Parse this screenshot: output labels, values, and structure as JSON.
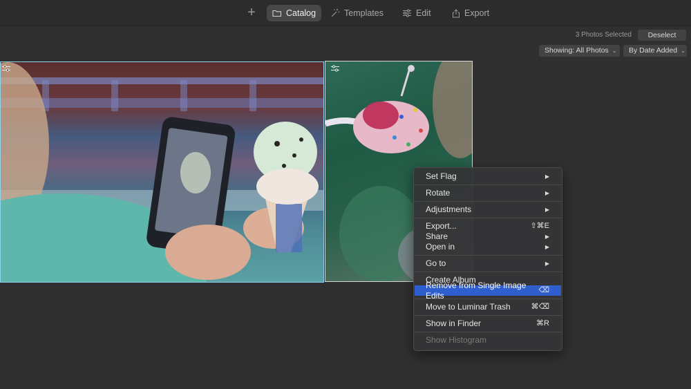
{
  "toolbar": {
    "add_label": "+",
    "tabs": [
      {
        "label": "Catalog",
        "icon": "folder-icon",
        "active": true
      },
      {
        "label": "Templates",
        "icon": "magic-wand-icon",
        "active": false
      },
      {
        "label": "Edit",
        "icon": "sliders-icon",
        "active": false
      },
      {
        "label": "Export",
        "icon": "export-icon",
        "active": false
      }
    ]
  },
  "header": {
    "selection_count": "3 Photos Selected",
    "deselect_label": "Deselect",
    "showing_label": "Showing: All Photos",
    "sort_label": "By Date Added"
  },
  "photos": [
    {
      "description_icon": "adjustments-icon",
      "selected": true
    },
    {
      "description_icon": "adjustments-icon",
      "selected": true
    }
  ],
  "context_menu": {
    "items": [
      {
        "label": "Set Flag",
        "shortcut": "",
        "submenu": true
      },
      {
        "label": "Rotate",
        "shortcut": "",
        "submenu": true
      },
      {
        "label": "Adjustments",
        "shortcut": "",
        "submenu": true
      },
      {
        "label": "Export...",
        "shortcut": "⇧⌘E",
        "submenu": false
      },
      {
        "label": "Share",
        "shortcut": "",
        "submenu": true
      },
      {
        "label": "Open in",
        "shortcut": "",
        "submenu": true
      },
      {
        "label": "Go to",
        "shortcut": "",
        "submenu": true
      },
      {
        "label": "Create Album",
        "shortcut": "",
        "submenu": false
      },
      {
        "label": "Remove from Single Image Edits",
        "shortcut": "⌫",
        "submenu": false
      },
      {
        "label": "Move to Luminar Trash",
        "shortcut": "⌘⌫",
        "submenu": false
      },
      {
        "label": "Show in Finder",
        "shortcut": "⌘R",
        "submenu": false
      },
      {
        "label": "Show Histogram",
        "shortcut": "",
        "submenu": false
      }
    ],
    "arrow_glyph": "▶",
    "highlight_color": "#2f5fcf"
  },
  "colors": {
    "background": "#303030",
    "selection_border": "#8fd4ee"
  }
}
